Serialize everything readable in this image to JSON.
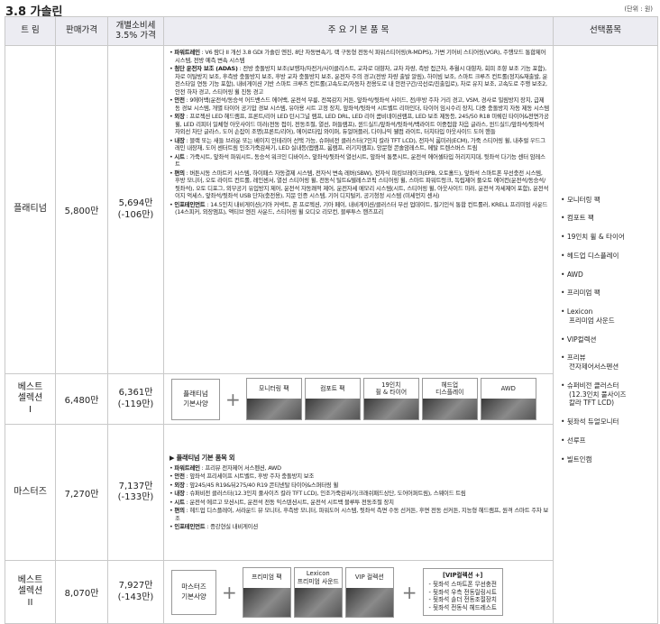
{
  "title": "3.8 가솔린",
  "unit": "(단위 : 원)",
  "headers": {
    "trim": "트 림",
    "price": "판매가격",
    "tax": "개별소비세\n3.5% 가격",
    "features": "주 요 기 본 품 목",
    "options": "선택품목"
  },
  "platinum": {
    "name": "플래티넘",
    "price": "5,800만",
    "tax": "5,694만\n(-106만)",
    "features": [
      {
        "h": "파워트레인",
        "t": " : V6 람다 II 개선 3.8 GDI 가솔린 엔진, 8단 자동변속기, 랙 구동형 전동식 파워스티어링(R-MDPS), 가변 기어비 스티어링(VGR), 주행모드 통합제어 시스템, 전방 예측 변속 시스템"
      },
      {
        "h": "첨단 운전자 보조 (ADAS)",
        "t": " : 전방 충돌방지 보조(보행자/자전거/사이클리스트, 교차로 대향차, 교차 차량, 측방 접근차, 추월시 대향차, 회피 조향 보조 기능 포함), 차로 이탈방지 보조, 후측방 충돌방지 보조, 후방 교차 충돌방지 보조, 운전자 주의 경고(전방 차량 출발 알림), 하이빔 보조, 스마트 크루즈 컨트롤(정지&재출발, 운전스타일 연동 기능 포함), 내비게이션 기반 스마트 크루즈 컨트롤(고속도로/자동차 전용도로 내 안전구간/곡선로/진출입로), 차로 유지 보조, 고속도로 주행 보조2, 안전 하차 경고, 스티어링 휠 진동 경고"
      },
      {
        "h": "안전",
        "t": " : 9에어백(운전석/동승석 어드밴스드 에어백, 운전석 무릎, 전복감지 커튼, 앞좌석/뒷좌석 사이드, 전/후방 주차 거리 경고, VSM, 경사로 밀림방지 장치, 급제동 경보 시스템, 개별 타이어 공기압 경보 시스템, 유아용 시트 고정 장치, 앞좌석/뒷좌석 시트벨트 리마인더, 타이어 임시수리 장치, 다중 충돌방지 자동 제동 시스템"
      },
      {
        "h": "외장",
        "t": " : 프로젝션 LED 헤드램프, 프론트/리어 LED 턴시그널 램프, LED DRL, LED 리어 콤비네이션램프, LED 보조 제동등, 245/50 R18 미쉐린 타이어&전면가공 휠, LED 리피터 일체형 아웃사이드 미러(전동 접이, 전동조절, 열선, 퍼들램프), 윈드실드/앞좌석/뒷좌석/백라이트 이중접합 차음 글라스, 윈드실드/앞좌석/뒷좌석 자외선 차단 글라스, 도어 손잡이 조명(프론트/리어), 에어로타입 와이퍼, 듀얼머플러, 다이나믹 웰컴 라이트, 터치타입 아웃사이드 도어 핸들"
      },
      {
        "h": "내장",
        "t": " : 블랙 또는 새들 브라운 또는 베이지 인테리어 선택 가능, 슈퍼비전 클러스터(7인치 칼라 TFT LCD), 전자식 룸미러(ECM), 가죽 스티어링 휠, 내추럴 우드그레인 내장재, 도어 센터트림 인조가죽감싸기, LED 실내등(맵램프, 룸램프, 러기지램프), 앙문형 콘솔암레스트, 메탈 트렌스버스 트림"
      },
      {
        "h": "시트",
        "t": " : 가죽시트, 앞좌석 파워시트, 동승석 워크인 디바이스, 앞좌석/뒷좌석 열선시트, 앞좌석 통풍시트, 운전석 에어셀타입 허리지지대, 뒷좌석 다기능 센터 암레스트"
      },
      {
        "h": "편의",
        "t": " : 버튼시동 스마트키 시스템, 하이패스 자동결제 시스템, 전자식 변속 레버(SBW), 전자식 파킹브레이크(EPB, 오토홀드), 앞좌석 스마트폰 무선충전 시스템, 후방 모니터, 오토 라이트 컨트롤, 레인센서, 열선 스티어링 휠, 전동식 틸트&텔레스코픽 스티어링 휠, 스마트 파워트렁크, 독립제어 풀오토 에어컨(운전석/동승석/뒷좌석), 오토 디포그, 외부공기 유입방지 제어, 운전석 자동쾌적 제어, 운전자세 메모리 시스템(시트, 스티어링 휠, 아웃사이드 미러, 운전석 자세제어 포함), 운전석 이지 억세스, 앞좌석/뒷좌석 USB 단자(충전용), 지문 인증 시스템, 기어 디지털키, 공기청정 시스템 (미세먼지 센서)"
      },
      {
        "h": "인포테인먼트",
        "t": " : 14.5인치 내비게이션(기아 커넥트, 폰 프로젝션, 기아 페이, 내비게이션/클러스터 무선 업데이트, 필기인식 통합 컨트롤러, KRELL 프리미엄 사운드(14스피커, 외장앰프), 액티브 엔진 사운드, 스티어링 휠 오디오 리모컨, 블루투스 핸즈프리"
      }
    ]
  },
  "bs1": {
    "name": "베스트\n셀렉션\nI",
    "price": "6,480만",
    "tax": "6,361만\n(-119만)",
    "base": "플래티넘\n기본사양",
    "items": [
      "모니터링 팩",
      "컴포트 팩",
      "19인치\n휠 & 타이어",
      "헤드업\n디스플레이",
      "AWD"
    ]
  },
  "masters": {
    "name": "마스터즈",
    "price": "7,270만",
    "tax": "7,137만\n(-133만)",
    "head": "▶ 플래티넘 기본 품목 외",
    "features": [
      {
        "h": "파워트레인",
        "t": " : 프리뷰 전자제어 서스펜션, AWD"
      },
      {
        "h": "안전",
        "t": " : 앞좌석 프리세이프 시트벨트, 후방 주차 충돌방지 보조"
      },
      {
        "h": "외장",
        "t": " : 앞245/45 R19&뒤275/40 R19 콘티넨탈 타이어&스퍼터링 휠"
      },
      {
        "h": "내장",
        "t": " : 슈퍼비전 클러스터(12.3인치 풀사이즈 칼라 TFT LCD), 인조가죽감싸기(크래쉬패드상단, 도어어퍼트림), 스웨이드 트림"
      },
      {
        "h": "시트",
        "t": " : 운전석 에르고 모션시트, 운전석 전동 익스텐션시트, 운전석 시트백 블루투 전동조절 장치"
      },
      {
        "h": "편의",
        "t": " : 헤드업 디스플레이, 서라운드 뷰 모니터, 후측방 모니터, 파워도어 시스템, 뒷좌석 측면 수동 선커튼, 후면 전동 선커튼, 지능형 헤드램프, 원격 스마트 주차 보조"
      },
      {
        "h": "인포테인먼트",
        "t": " : 증강현실 내비게이션"
      }
    ]
  },
  "bs2": {
    "name": "베스트\n셀렉션\nII",
    "price": "8,070만",
    "tax": "7,927만\n(-143만)",
    "base": "마스터즈\n기본사양",
    "items": [
      "프리미엄 팩",
      "Lexicon\n프리미엄 사운드",
      "VIP 컬렉션"
    ],
    "vip_title": "[VIP컬렉션 +]",
    "vip_items": [
      "- 뒷좌석 스마트폰 무선충전",
      "- 뒷좌석 우측 전동릴링시트",
      "- 뒷좌석 솔더 전동조절장치",
      "- 뒷좌석 전동식 헤드레스트"
    ]
  },
  "options": [
    "모니터링 팩",
    "컴포트 팩",
    "19인치 휠 & 타이어",
    "헤드업 디스플레이",
    "AWD",
    "프리미엄 팩",
    "Lexicon\n프리미엄 사운드",
    "VIP컬렉션",
    "프리뷰\n전자제어서스펜션",
    "슈퍼비전 클러스터\n(12.3인치 풀사이즈\n칼라 TFT LCD)",
    "뒷좌석 듀얼모니터",
    "선루프",
    "빌트인캠"
  ]
}
